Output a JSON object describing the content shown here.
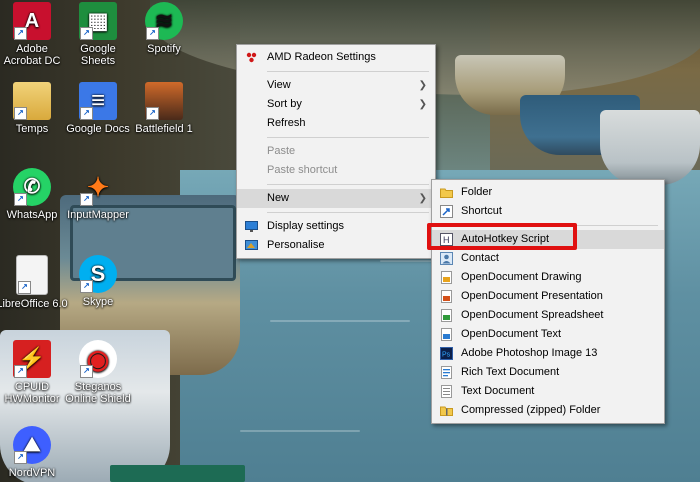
{
  "desktop": {
    "icons": [
      {
        "name": "adobe-acrobat-icon",
        "label": "Adobe Acrobat DC",
        "glyph": "A",
        "color": "#c8102e"
      },
      {
        "name": "google-sheets-icon",
        "label": "Google Sheets",
        "glyph": "▦",
        "color": "#1e8e3e"
      },
      {
        "name": "spotify-icon",
        "label": "Spotify",
        "glyph": "≋",
        "color": "#1db954"
      },
      {
        "name": "temps-folder-icon",
        "label": "Temps",
        "glyph": "",
        "color": "#e9c46a"
      },
      {
        "name": "google-docs-icon",
        "label": "Google Docs",
        "glyph": "≡",
        "color": "#3b78e7"
      },
      {
        "name": "battlefield-icon",
        "label": "Battlefield 1",
        "glyph": "",
        "color": "#8a4a2a"
      },
      {
        "name": "whatsapp-icon",
        "label": "WhatsApp",
        "glyph": "✆",
        "color": "#25d366"
      },
      {
        "name": "inputmapper-icon",
        "label": "InputMapper",
        "glyph": "✦",
        "color": "#ff7a18"
      },
      {
        "name": "libreoffice-icon",
        "label": "LibreOffice 6.0",
        "glyph": "",
        "color": "#f4f4f4"
      },
      {
        "name": "skype-icon",
        "label": "Skype",
        "glyph": "S",
        "color": "#00aff0"
      },
      {
        "name": "cpuid-icon",
        "label": "CPUID HWMonitor",
        "glyph": "⚡",
        "color": "#d62020"
      },
      {
        "name": "steganos-icon",
        "label": "Steganos Online Shield",
        "glyph": "◉",
        "color": "#e02020"
      },
      {
        "name": "nordvpn-icon",
        "label": "NordVPN",
        "glyph": "⛰",
        "color": "#3e5fff"
      }
    ]
  },
  "context_menu": {
    "items": [
      {
        "name": "amd-radeon-settings-item",
        "label": "AMD Radeon Settings",
        "icon": "amd-radeon-icon"
      },
      {
        "name": "view-item",
        "label": "View",
        "submenu": true
      },
      {
        "name": "sort-by-item",
        "label": "Sort by",
        "submenu": true
      },
      {
        "name": "refresh-item",
        "label": "Refresh"
      },
      {
        "name": "paste-item",
        "label": "Paste",
        "disabled": true
      },
      {
        "name": "paste-shortcut-item",
        "label": "Paste shortcut",
        "disabled": true
      },
      {
        "name": "new-item",
        "label": "New",
        "submenu": true,
        "active": true
      },
      {
        "name": "display-settings-item",
        "label": "Display settings",
        "icon": "display-settings-icon"
      },
      {
        "name": "personalise-item",
        "label": "Personalise",
        "icon": "personalise-icon"
      }
    ]
  },
  "new_submenu": {
    "items": [
      {
        "name": "new-folder-item",
        "label": "Folder",
        "icon": "folder-icon"
      },
      {
        "name": "new-shortcut-item",
        "label": "Shortcut",
        "icon": "shortcut-icon"
      },
      {
        "name": "new-autohotkey-script-item",
        "label": "AutoHotkey Script",
        "icon": "autohotkey-icon",
        "highlighted": true
      },
      {
        "name": "new-contact-item",
        "label": "Contact",
        "icon": "contact-icon"
      },
      {
        "name": "new-opendocument-drawing-item",
        "label": "OpenDocument Drawing",
        "icon": "odg-icon"
      },
      {
        "name": "new-opendocument-presentation-item",
        "label": "OpenDocument Presentation",
        "icon": "odp-icon"
      },
      {
        "name": "new-opendocument-spreadsheet-item",
        "label": "OpenDocument Spreadsheet",
        "icon": "ods-icon"
      },
      {
        "name": "new-opendocument-text-item",
        "label": "OpenDocument Text",
        "icon": "odt-icon"
      },
      {
        "name": "new-photoshop-image-item",
        "label": "Adobe Photoshop Image 13",
        "icon": "photoshop-icon"
      },
      {
        "name": "new-rich-text-item",
        "label": "Rich Text Document",
        "icon": "rtf-icon"
      },
      {
        "name": "new-text-document-item",
        "label": "Text Document",
        "icon": "txt-icon"
      },
      {
        "name": "new-compressed-folder-item",
        "label": "Compressed (zipped) Folder",
        "icon": "zip-folder-icon"
      }
    ]
  },
  "colors": {
    "highlight_box": "#e01010",
    "menu_bg": "#f2f2f2"
  }
}
